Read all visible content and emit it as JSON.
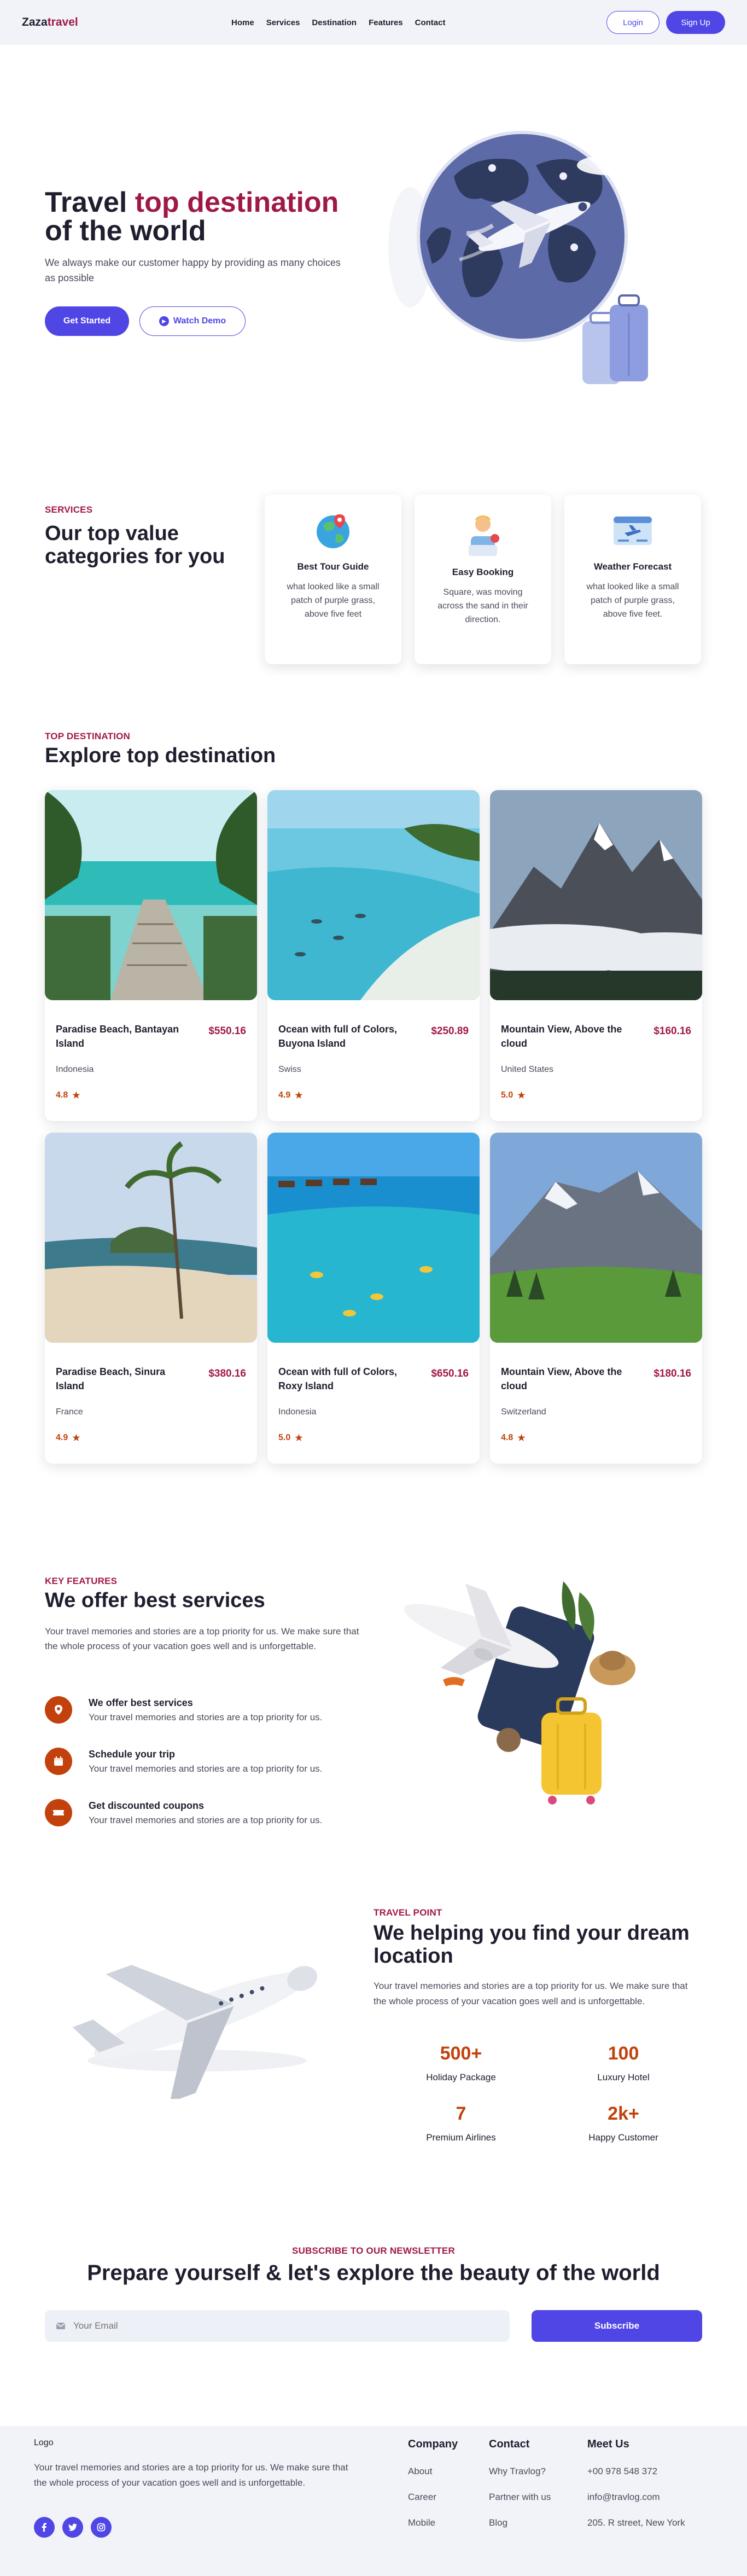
{
  "brand": {
    "name_main": "Zaza",
    "name_accent": "travel"
  },
  "nav": {
    "links": [
      "Home",
      "Services",
      "Destination",
      "Features",
      "Contact"
    ],
    "login": "Login",
    "signup": "Sign Up"
  },
  "hero": {
    "title_plain": "Travel ",
    "title_highlight": "top destination",
    "title_end": "of the world",
    "subtitle": "We always make our customer happy by providing as many choices as possible",
    "cta_primary": "Get Started",
    "cta_secondary": "Watch Demo"
  },
  "services": {
    "kicker": "SERVICES",
    "title": "Our top value categories for you",
    "cards": [
      {
        "title": "Best Tour Guide",
        "text": "what looked like a small patch of purple grass, above five feet",
        "icon": "globe-icon"
      },
      {
        "title": "Easy Booking",
        "text": "Square, was moving across the sand in their direction.",
        "icon": "booking-person-icon"
      },
      {
        "title": "Weather Forecast",
        "text": "what looked like a small patch of purple grass, above five feet.",
        "icon": "flight-board-icon"
      }
    ]
  },
  "destinations": {
    "kicker": "TOP DESTINATION",
    "title": "Explore top destination",
    "items": [
      {
        "name": "Paradise Beach, Bantayan Island",
        "price": "$550.16",
        "location": "Indonesia",
        "rating": "4.8"
      },
      {
        "name": "Ocean with full of Colors, Buyona Island",
        "price": "$250.89",
        "location": "Swiss",
        "rating": "4.9"
      },
      {
        "name": "Mountain View, Above the cloud",
        "price": "$160.16",
        "location": "United States",
        "rating": "5.0"
      },
      {
        "name": "Paradise Beach, Sinura Island",
        "price": "$380.16",
        "location": "France",
        "rating": "4.9"
      },
      {
        "name": "Ocean with full of Colors, Roxy Island",
        "price": "$650.16",
        "location": "Indonesia",
        "rating": "5.0"
      },
      {
        "name": "Mountain View, Above the cloud",
        "price": "$180.16",
        "location": "Switzerland",
        "rating": "4.8"
      }
    ]
  },
  "features": {
    "kicker": "KEY FEATURES",
    "title": "We offer best services",
    "lead": "Your travel memories and stories are a top priority for us. We make sure that the whole process of your vacation goes well and is unforgettable.",
    "items": [
      {
        "title": "We offer best services",
        "text": "Your travel memories and stories are a top priority for us.",
        "icon": "location-pin-icon"
      },
      {
        "title": "Schedule your trip",
        "text": "Your travel memories and stories are a top priority for us.",
        "icon": "calendar-icon"
      },
      {
        "title": "Get discounted coupons",
        "text": "Your travel memories and stories are a top priority for us.",
        "icon": "ticket-icon"
      }
    ]
  },
  "travel_point": {
    "kicker": "TRAVEL POINT",
    "title": "We helping you find your dream location",
    "lead": "Your travel memories and stories are a top priority for us. We make sure that the whole process of your vacation goes well and is unforgettable.",
    "stats": [
      {
        "value": "500+",
        "label": "Holiday Package"
      },
      {
        "value": "100",
        "label": "Luxury Hotel"
      },
      {
        "value": "7",
        "label": "Premium Airlines"
      },
      {
        "value": "2k+",
        "label": "Happy Customer"
      }
    ]
  },
  "newsletter": {
    "kicker": "SUBSCRIBE TO OUR NEWSLETTER",
    "title": "Prepare yourself & let's explore the beauty of the world",
    "placeholder": "Your Email",
    "button": "Subscribe"
  },
  "footer": {
    "logo": "Logo",
    "desc": "Your travel memories and stories are a top priority for us. We make sure that the whole process of your vacation goes well and is unforgettable.",
    "columns": [
      {
        "title": "Company",
        "links": [
          "About",
          "Career",
          "Mobile"
        ]
      },
      {
        "title": "Contact",
        "links": [
          "Why Travlog?",
          "Partner with us",
          "Blog"
        ]
      },
      {
        "title": "Meet Us",
        "links": [
          "+00 978 548 372",
          "info@travlog.com",
          "205. R street, New York"
        ]
      }
    ]
  },
  "colors": {
    "primary": "#4f46e5",
    "accent": "#a01847",
    "orange": "#c2410c"
  }
}
